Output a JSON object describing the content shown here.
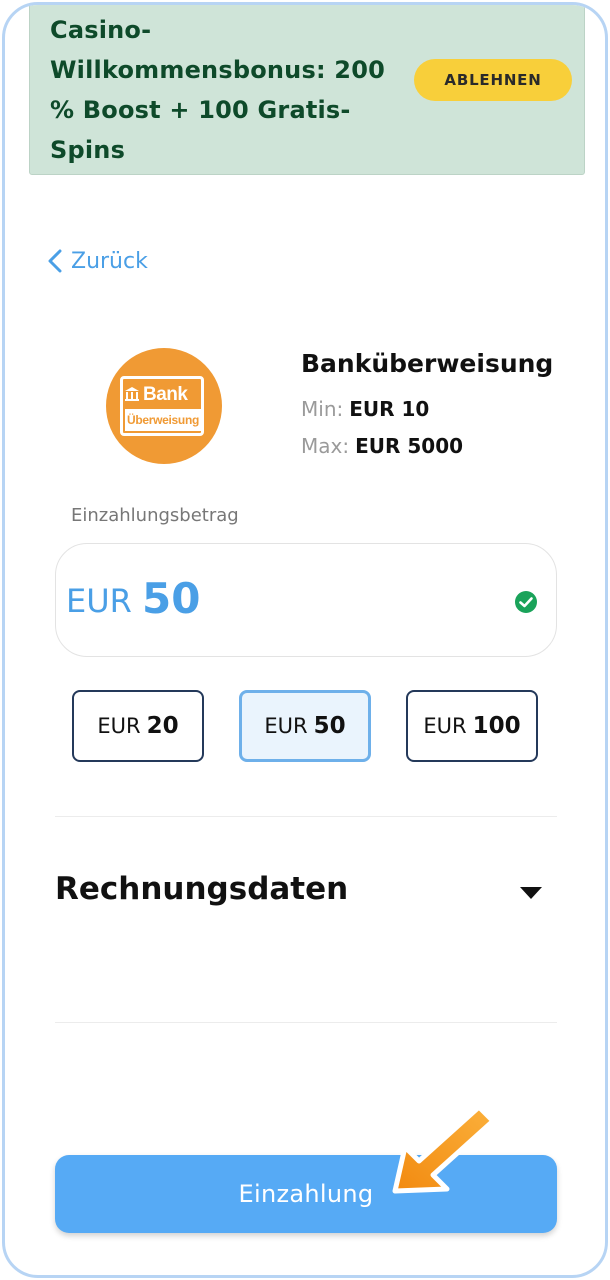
{
  "promo": {
    "text": "Casino-Willkommensbonus: 200 % Boost + 100 Gratis-Spins",
    "decline_label": "ABLEHNEN"
  },
  "nav": {
    "back_label": "Zurück"
  },
  "payment_method": {
    "name": "Banküberweisung",
    "logo_text_top": "Bank",
    "logo_text_bottom": "Überweisung",
    "min_label": "Min:",
    "min_value": "EUR 10",
    "max_label": "Max:",
    "max_value": "EUR 5000"
  },
  "amount": {
    "label": "Einzahlungsbetrag",
    "currency": "EUR",
    "value": "50"
  },
  "quick_amounts": [
    {
      "currency": "EUR",
      "value": "20",
      "selected": false
    },
    {
      "currency": "EUR",
      "value": "50",
      "selected": true
    },
    {
      "currency": "EUR",
      "value": "100",
      "selected": false
    }
  ],
  "billing": {
    "title": "Rechnungsdaten"
  },
  "submit": {
    "label": "Einzahlung"
  },
  "colors": {
    "accent_blue": "#56aaf5",
    "link_blue": "#4a9fe6",
    "promo_bg": "#cfe4d8",
    "promo_text": "#0e4a2a",
    "decline_bg": "#f8cf3a",
    "logo_orange": "#f09a34",
    "success_green": "#1aa35a",
    "pointer_arrow": "#f79b1c"
  },
  "icons": {
    "back": "chevron-left-icon",
    "amount_status": "check-circle-icon",
    "billing_toggle": "caret-down-icon",
    "pointer": "arrow-pointer-icon",
    "logo_bank": "bank-building-icon"
  }
}
